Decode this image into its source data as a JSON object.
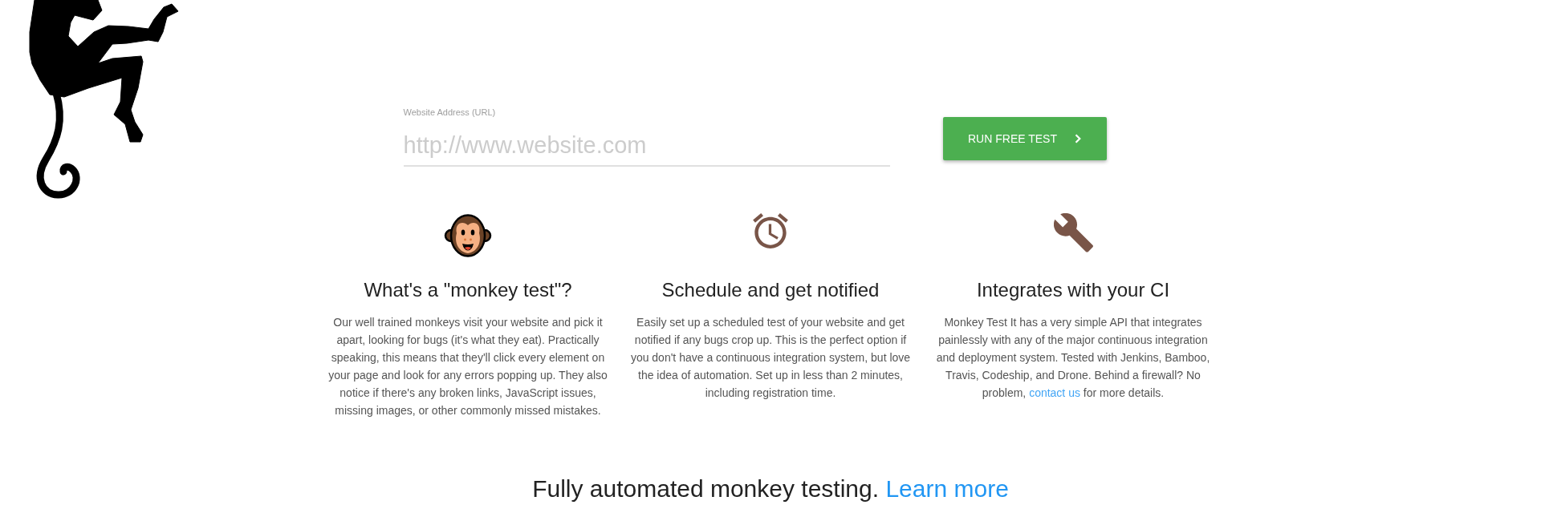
{
  "url_form": {
    "label": "Website Address (URL)",
    "placeholder": "http://www.website.com",
    "button": "RUN FREE TEST"
  },
  "features": [
    {
      "kind": "monkey",
      "title": "What's a \"monkey test\"?",
      "description": "Our well trained monkeys visit your website and pick it apart, looking for bugs (it's what they eat). Practically speaking, this means that they'll click every element on your page and look for any errors popping up. They also notice if there's any broken links, JavaScript issues, missing images, or other commonly missed mistakes."
    },
    {
      "kind": "clock",
      "title": "Schedule and get notified",
      "description": "Easily set up a scheduled test of your website and get notified if any bugs crop up. This is the perfect option if you don't have a continuous integration system, but love the idea of automation. Set up in less than 2 minutes, including registration time."
    },
    {
      "kind": "wrench",
      "title": "Integrates with your CI",
      "description": "Monkey Test It has a very simple API that integrates painlessly with any of the major continuous integration and deployment system. Tested with Jenkins, Bamboo, Travis, Codeship, and Drone. Behind a firewall? No problem,",
      "link": "contact us",
      "after_link": "for more details."
    }
  ],
  "footer": {
    "text": "Fully automated monkey testing.",
    "link": "Learn more"
  }
}
